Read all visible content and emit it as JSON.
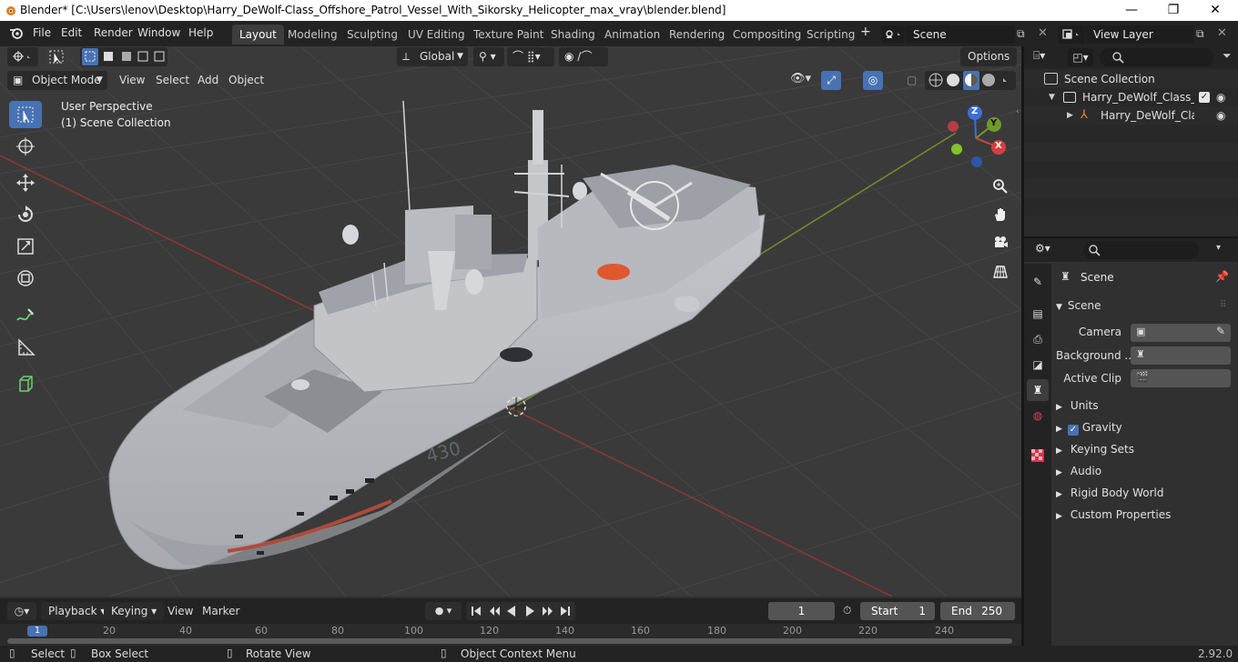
{
  "window": {
    "title": "Blender* [C:\\Users\\lenov\\Desktop\\Harry_DeWolf-Class_Offshore_Patrol_Vessel_With_Sikorsky_Helicopter_max_vray\\blender.blend]",
    "minimize": "—",
    "maximize": "❐",
    "close": "✕"
  },
  "menubar": {
    "items": [
      "File",
      "Edit",
      "Render",
      "Window",
      "Help"
    ]
  },
  "workspaces": {
    "tabs": [
      "Layout",
      "Modeling",
      "Sculpting",
      "UV Editing",
      "Texture Paint",
      "Shading",
      "Animation",
      "Rendering",
      "Compositing",
      "Scripting"
    ],
    "active": "Layout",
    "add": "+"
  },
  "scene_selector": {
    "value": "Scene"
  },
  "view_layer_selector": {
    "value": "View Layer"
  },
  "viewport_header": {
    "mode": "Object Mode",
    "menus": [
      "View",
      "Select",
      "Add",
      "Object"
    ],
    "transform_orientation": "Global",
    "options": "Options"
  },
  "viewport": {
    "view_name": "User Perspective",
    "collection": "(1) Scene Collection",
    "hull_number": "430",
    "gizmo": {
      "x": "X",
      "y": "Y",
      "z": "Z"
    },
    "colors": {
      "bg": "#3a3a3a",
      "grid": "#454545",
      "x_axis": "#a33b3b",
      "y_axis": "#6f8a2a",
      "hull": "#b4b6bb"
    }
  },
  "outliner": {
    "root": "Scene Collection",
    "rows": [
      {
        "label": "Harry_DeWolf_Class_Offs"
      },
      {
        "label": "Harry_DeWolf_Class_"
      }
    ]
  },
  "properties": {
    "context": "Scene",
    "section": "Scene",
    "fields": [
      {
        "label": "Camera"
      },
      {
        "label": "Background ..."
      },
      {
        "label": "Active Clip"
      }
    ],
    "subsections": [
      "Units",
      "Gravity",
      "Keying Sets",
      "Audio",
      "Rigid Body World",
      "Custom Properties"
    ]
  },
  "timeline": {
    "menus": [
      "Playback",
      "Keying",
      "View",
      "Marker"
    ],
    "current_frame": "1",
    "start_label": "Start",
    "start": "1",
    "end_label": "End",
    "end": "250",
    "ruler": [
      "1",
      "20",
      "40",
      "60",
      "80",
      "100",
      "120",
      "140",
      "160",
      "180",
      "200",
      "220",
      "240"
    ]
  },
  "statusbar": {
    "select": "Select",
    "box_select": "Box Select",
    "rotate_view": "Rotate View",
    "context_menu": "Object Context Menu",
    "version": "2.92.0"
  }
}
